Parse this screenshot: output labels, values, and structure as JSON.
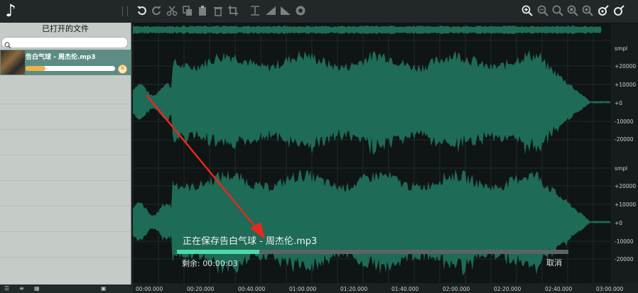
{
  "toolbar": {
    "icons": [
      "music-note-icon",
      "undo-icon",
      "redo-icon",
      "cut-icon",
      "copy-icon",
      "paste-icon",
      "delete-icon",
      "crop-icon",
      "trim-icon",
      "fade-in-icon",
      "fade-out-icon",
      "normalize-icon",
      "zoom-in-icon",
      "zoom-out-icon",
      "zoom-fit-icon",
      "zoom-selection-icon",
      "zoom-in-vertical-icon",
      "zoom-out-vertical-icon"
    ]
  },
  "sidebar": {
    "title": "已打开的文件",
    "search": {
      "placeholder": "",
      "value": ""
    },
    "files": [
      {
        "name": "告白气球 - 周杰伦.mp3",
        "progress": 0.22
      }
    ]
  },
  "waveform": {
    "color": "#1e6b57",
    "background": "#0f1414"
  },
  "ruler": {
    "channel1": [
      "smpl",
      "+20000",
      "+10000",
      "+0",
      "-10000",
      "-20000"
    ],
    "channel2": [
      "smpl",
      "+20000",
      "+10000",
      "+0",
      "-10000",
      "-20000"
    ]
  },
  "timeline": {
    "labels": [
      "00:00.000",
      "00:20.000",
      "00:40.000",
      "01:00.000",
      "01:20.000",
      "01:40.000",
      "02:00.000",
      "02:20.000",
      "02:40.000",
      "03:00.000"
    ]
  },
  "save_dialog": {
    "title": "正在保存告白气球 - 周杰伦.mp3",
    "progress": 0.21,
    "remaining_label": "剩余: 00:00:03",
    "cancel_label": "取消",
    "progress_color": "#4ed7a9"
  },
  "annotation": {
    "arrow_color": "#e8281e"
  }
}
